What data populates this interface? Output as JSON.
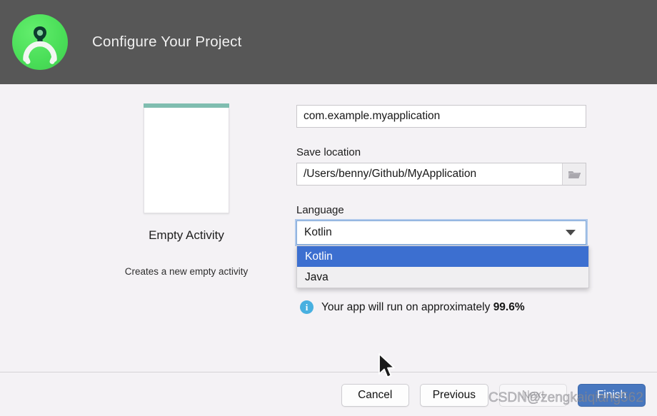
{
  "header": {
    "title": "Configure Your Project",
    "logo_icon": "android-studio-logo-icon",
    "background_color": "#575757"
  },
  "preview": {
    "template_name": "Empty Activity",
    "template_description": "Creates a new empty activity",
    "accent_color": "#7fbdb0"
  },
  "form": {
    "package_name": {
      "name": "package-name-field",
      "value": "com.example.myapplication",
      "placeholder": "com.example.myapplication"
    },
    "save_location": {
      "label": "Save location",
      "value": "/Users/benny/Github/MyApplication",
      "placeholder": "/Users/benny/Github/MyApplication",
      "browse_icon": "folder-icon"
    },
    "language": {
      "label": "Language",
      "selected": "Kotlin",
      "options": [
        "Kotlin",
        "Java"
      ],
      "expanded": true,
      "arrow_icon": "chevron-down-icon",
      "highlight_color": "#3c6fd0"
    }
  },
  "info": {
    "icon": "info-icon",
    "text_prefix": "Your app will run on approximately ",
    "percentage": "99.6%",
    "icon_color": "#48b0e0"
  },
  "footer": {
    "buttons": [
      {
        "label": "Cancel",
        "name": "cancel-button",
        "style": "default"
      },
      {
        "label": "Previous",
        "name": "previous-button",
        "style": "default"
      },
      {
        "label": "Next",
        "name": "next-button",
        "style": "disabled"
      },
      {
        "label": "Finish",
        "name": "finish-button",
        "style": "primary"
      }
    ],
    "primary_color": "#4877bf"
  },
  "watermark": {
    "text": "CSDN@zengkaiqiang562"
  }
}
